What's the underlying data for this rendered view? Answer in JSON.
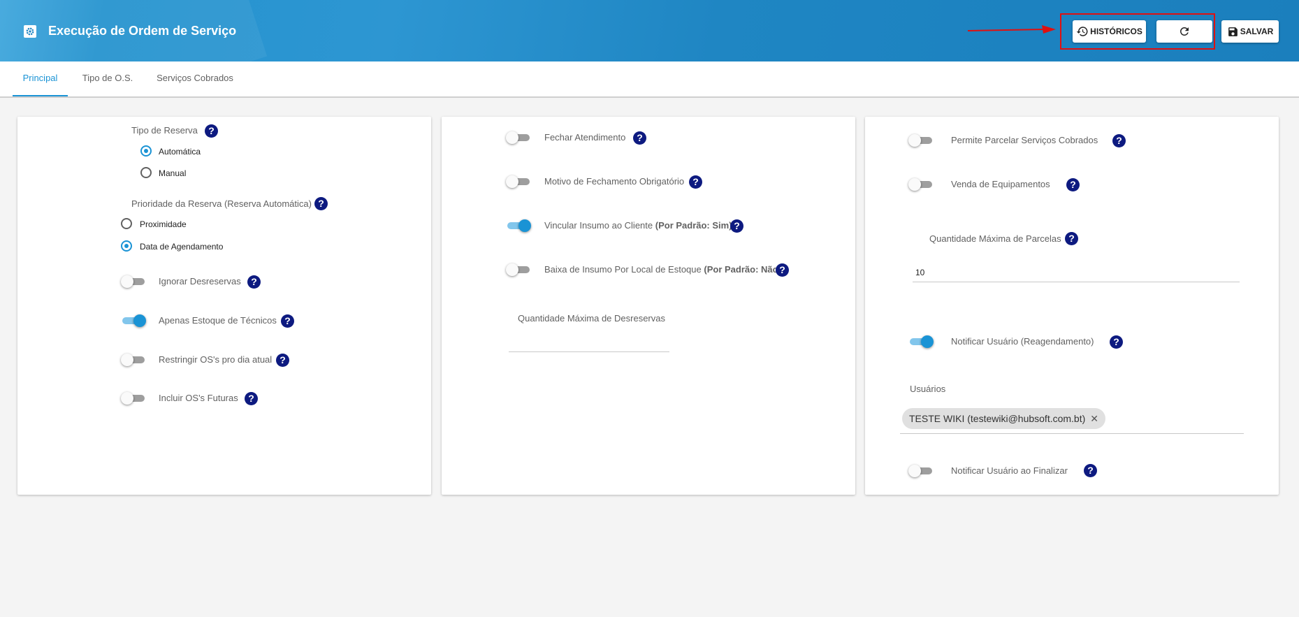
{
  "header": {
    "title": "Execução de Ordem de Serviço",
    "buttons": {
      "historicos": "HISTÓRICOS",
      "salvar": "SALVAR"
    },
    "icons": {
      "title": "gear-icon",
      "historicos": "history-icon",
      "refresh": "refresh-icon",
      "salvar": "save-icon"
    }
  },
  "tabs": [
    {
      "label": "Principal",
      "active": true
    },
    {
      "label": "Tipo de O.S.",
      "active": false
    },
    {
      "label": "Serviços Cobrados",
      "active": false
    }
  ],
  "card1": {
    "tipo_reserva": {
      "label": "Tipo de Reserva",
      "options": [
        {
          "label": "Automática",
          "selected": true
        },
        {
          "label": "Manual",
          "selected": false
        }
      ]
    },
    "prioridade": {
      "label": "Prioridade da Reserva (Reserva Automática)",
      "options": [
        {
          "label": "Proximidade",
          "selected": false
        },
        {
          "label": "Data de Agendamento",
          "selected": true
        }
      ]
    },
    "toggles": [
      {
        "label": "Ignorar Desreservas",
        "on": false
      },
      {
        "label": "Apenas Estoque de Técnicos",
        "on": true
      },
      {
        "label": "Restringir OS's pro dia atual",
        "on": false
      },
      {
        "label": "Incluir OS's Futuras",
        "on": false
      }
    ]
  },
  "card2": {
    "toggles": [
      {
        "label": "Fechar Atendimento",
        "on": false
      },
      {
        "label": "Motivo de Fechamento Obrigatório",
        "on": false
      },
      {
        "label": "Vincular Insumo ao Cliente",
        "bold_suffix": "(Por Padrão: Sim)",
        "on": true
      },
      {
        "label": "Baixa de Insumo Por Local de Estoque",
        "bold_suffix": "(Por Padrão: Não)",
        "on": false
      }
    ],
    "max_desreservas": {
      "label": "Quantidade Máxima de Desreservas",
      "value": ""
    }
  },
  "card3": {
    "toggles": [
      {
        "label": "Permite Parcelar Serviços Cobrados",
        "on": false
      },
      {
        "label": "Venda de Equipamentos",
        "on": false
      }
    ],
    "max_parcelas": {
      "label": "Quantidade Máxima de Parcelas",
      "value": "10"
    },
    "notificar_reagendamento": {
      "label": "Notificar Usuário (Reagendamento)",
      "on": true
    },
    "usuarios": {
      "label": "Usuários",
      "chips": [
        "TESTE WIKI (testewiki@hubsoft.com.bt)"
      ]
    },
    "notificar_finalizar": {
      "label": "Notificar Usuário ao Finalizar",
      "on": false
    }
  },
  "help_symbol": "?",
  "colors": {
    "primary": "#1a93d5",
    "help": "#0d1a80",
    "highlight": "#e01010"
  }
}
